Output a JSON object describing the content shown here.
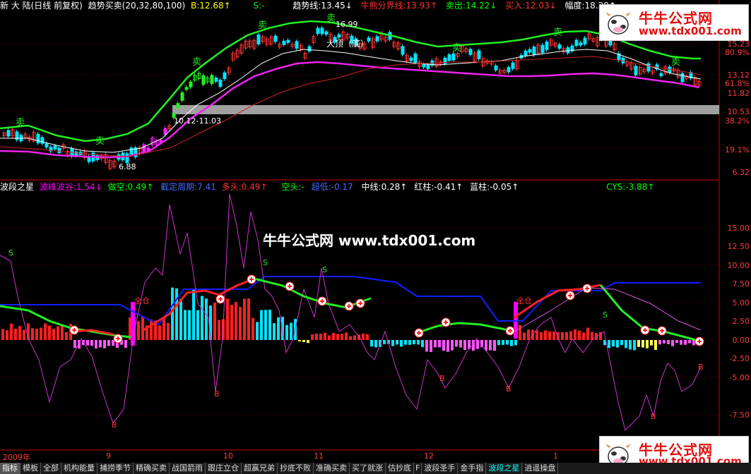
{
  "top_header": {
    "stock": "新 大 陆(日线 前复权)",
    "indicator": "趋势买卖(20,32,80,100)",
    "b": "B:12.68↑",
    "s": "S:-",
    "trend": "趋势线:13.45↓",
    "bull_bear": "牛熊分界线:13.93↑",
    "sell": "卖出:14.22↓",
    "buy": "买入:12.03↓",
    "range": "幅度:18.20↑"
  },
  "bottom_header": {
    "name": "波段之星",
    "peak": "波峰波谷:1.54↓",
    "short": "做空:0.49↑",
    "cycle": "截定周期:7.41",
    "long": "多头:0.49↑",
    "empty": "空头:-",
    "low": "超低:-0.17",
    "mid": "中线:0.28↑",
    "red": "红柱:-0.41↑",
    "blue": "蓝柱:-0.05↑",
    "cys": "CYS:-3.88↑"
  },
  "top_axis": [
    "15.23",
    "80.9%",
    "13.12",
    "61.8%",
    "11.82",
    "10.53",
    "38.2%",
    "19.1%",
    "6.32"
  ],
  "bottom_axis": [
    "15.00",
    "12.50",
    "10.00",
    "7.50",
    "5.00",
    "2.50",
    "0.00",
    "-2.50",
    "-5.00",
    "-7.50"
  ],
  "dates": [
    "2009年",
    "9",
    "10",
    "11",
    "12",
    "1"
  ],
  "chart_labels": {
    "high_price": "16.99",
    "top_bottom": "大顶（底）",
    "low_price": "6.88",
    "low_date": "10.12-11.03",
    "full": "全仓",
    "s_mark": "S",
    "b_mark": "B",
    "sell_mark": "卖"
  },
  "watermark": {
    "name": "牛牛公式网",
    "url": "www.tdx001.com",
    "center": "牛牛公式网 www.tdx001.com"
  },
  "tabs": [
    "指标",
    "模板",
    "全部",
    "机构能量",
    "捕捞季节",
    "精确买卖",
    "战国箭雨",
    "跟庄立仓",
    "超赢兄弟",
    "抄底不败",
    "准确买卖",
    "买了就涨",
    "估抄底",
    "波段圣手",
    "金手指",
    "波段之星",
    "逍遥操盘"
  ],
  "tab_f_marker": "F",
  "colors": {
    "green": "#00ff00",
    "magenta": "#ff00ff",
    "red": "#ff2020",
    "cyan": "#00e5ff",
    "blue": "#0000ff",
    "gray": "#a0a0a0"
  }
}
